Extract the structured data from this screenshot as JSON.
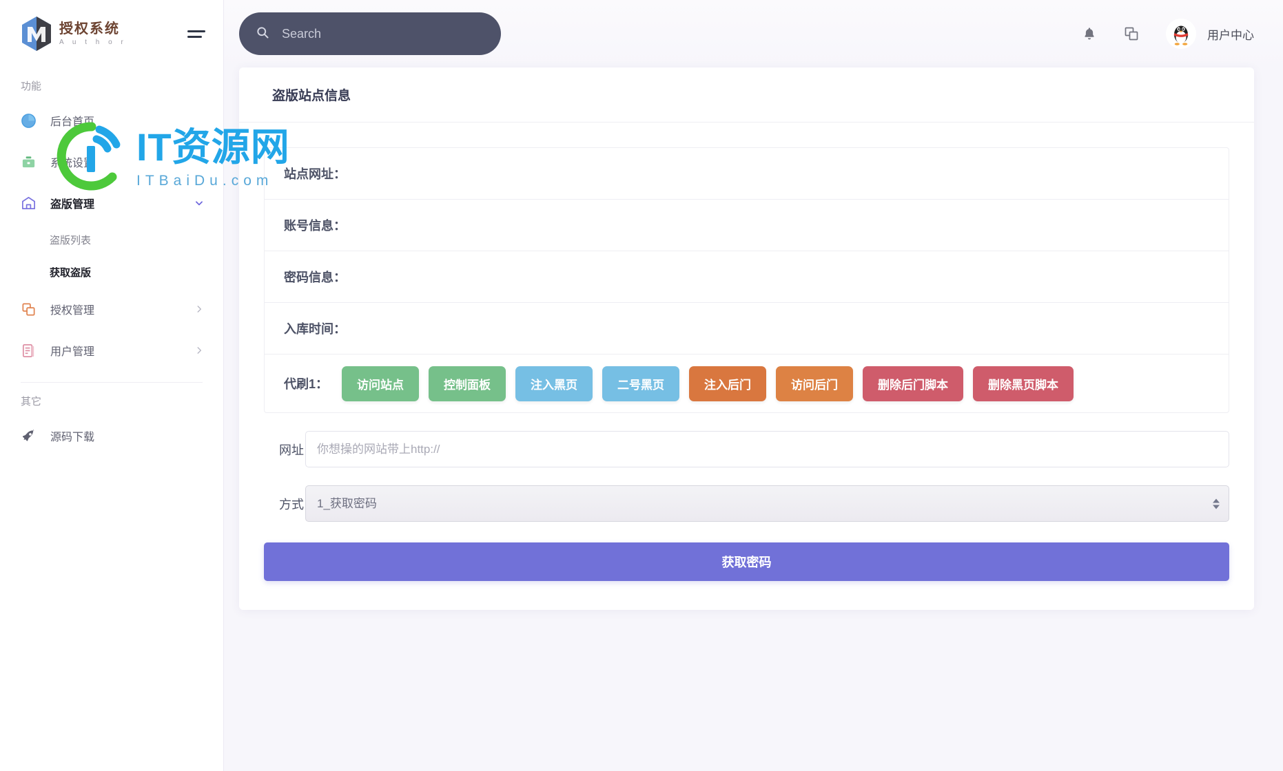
{
  "brand": {
    "name_cn": "授权系统",
    "name_en": "A u t h o r"
  },
  "search": {
    "placeholder": "Search",
    "value": ""
  },
  "topbar": {
    "user_name": "用户中心"
  },
  "sidebar": {
    "section_functions": "功能",
    "section_other": "其它",
    "items": [
      {
        "label": "后台首页",
        "icon": "pie-chart-icon",
        "chevron": "none"
      },
      {
        "label": "系统设置",
        "icon": "briefcase-icon",
        "chevron": "none"
      },
      {
        "label": "盗版管理",
        "icon": "store-icon",
        "chevron": "down"
      },
      {
        "label": "授权管理",
        "icon": "copy-icon",
        "chevron": "right"
      },
      {
        "label": "用户管理",
        "icon": "document-icon",
        "chevron": "right"
      }
    ],
    "sub_items": [
      {
        "label": "盗版列表",
        "active": false
      },
      {
        "label": "获取盗版",
        "active": true
      }
    ],
    "other_items": [
      {
        "label": "源码下载",
        "icon": "rocket-icon"
      }
    ]
  },
  "card": {
    "title": "盗版站点信息",
    "info_rows": [
      "站点网址：",
      "账号信息：",
      "密码信息：",
      "入库时间："
    ],
    "action_row_label": "代刷1：",
    "action_buttons": [
      {
        "label": "访问站点",
        "color": "#76c08a"
      },
      {
        "label": "控制面板",
        "color": "#76c08a"
      },
      {
        "label": "注入黑页",
        "color": "#76bfe4"
      },
      {
        "label": "二号黑页",
        "color": "#76bfe4"
      },
      {
        "label": "注入后门",
        "color": "#d9773f"
      },
      {
        "label": "访问后门",
        "color": "#dd8244"
      },
      {
        "label": "删除后门脚本",
        "color": "#cf5c6b"
      },
      {
        "label": "删除黑页脚本",
        "color": "#cf5c6b"
      }
    ],
    "url_field": {
      "label": "网址",
      "placeholder": "你想操的网站带上http://",
      "value": ""
    },
    "method_field": {
      "label": "方式",
      "selected": "1_获取密码",
      "options": [
        "1_获取密码"
      ]
    },
    "submit_label": "获取密码"
  },
  "watermark": {
    "main": "IT资源网",
    "sub": "ITBaiDu.com"
  },
  "colors": {
    "accent": "#7171d8",
    "search_bg": "#4e5269",
    "page_bg": "#f7f6fb",
    "watermark_blue": "#22a6e8",
    "watermark_green": "#4dc93b"
  }
}
